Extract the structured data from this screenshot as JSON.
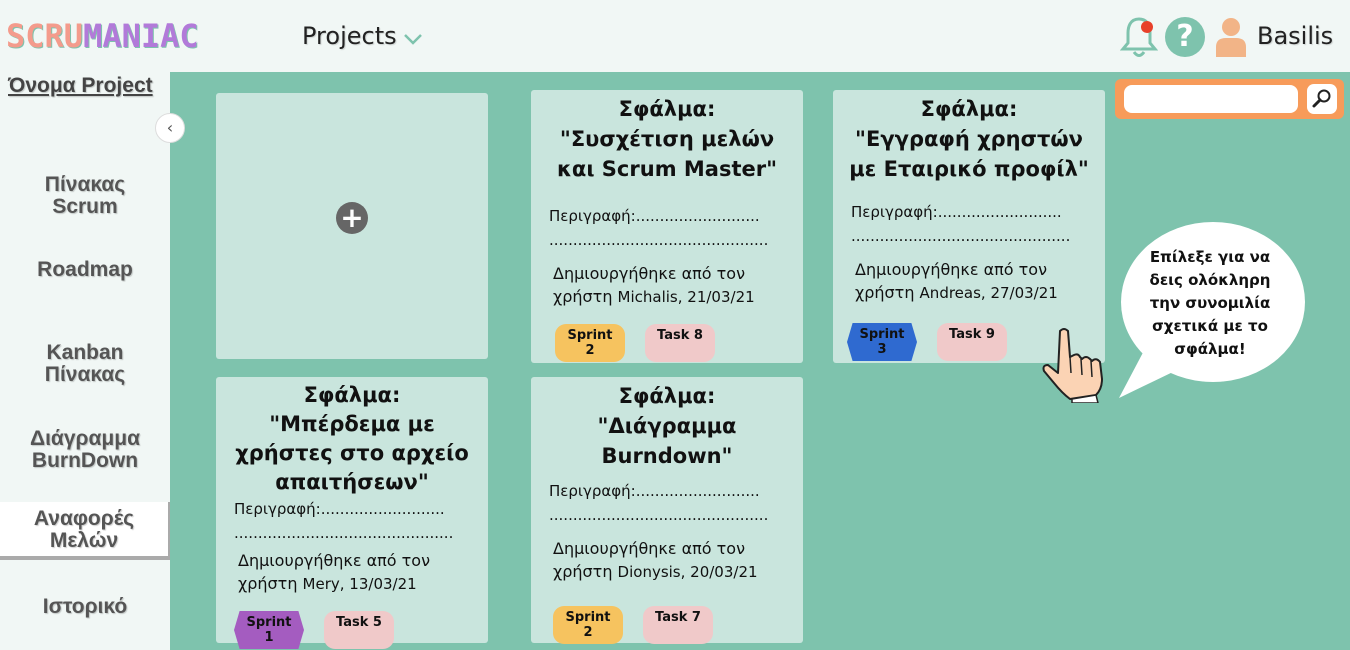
{
  "header": {
    "logo_part1": "SCRU",
    "logo_part2": "MANIAC",
    "projects_label": "Projects",
    "username": "Basilis",
    "help_symbol": "?",
    "icons": [
      "bell-icon",
      "help-icon",
      "user-icon",
      "chevron-down-icon"
    ],
    "notification_dot_color": "#e8402a"
  },
  "sidebar": {
    "project_name": "Όνομα Project",
    "collapse_symbol": "‹",
    "items": [
      {
        "label_line1": "Πίνακας",
        "label_line2": "Scrum"
      },
      {
        "label_line1": "Roadmap",
        "label_line2": ""
      },
      {
        "label_line1": "Kanban",
        "label_line2": "Πίνακας"
      },
      {
        "label_line1": "Διάγραμμα",
        "label_line2": "BurnDown"
      },
      {
        "label_line1": "Αναφορές",
        "label_line2": "Μελών",
        "active": true
      },
      {
        "label_line1": "Ιστορικό",
        "label_line2": ""
      }
    ]
  },
  "main": {
    "add_symbol": "+",
    "cards": [
      {
        "title_lines": [
          "Σφάλμα:",
          "\"Συσχέτιση μελών",
          "και Scrum Master\""
        ],
        "desc_line1": "Περιγραφή:..........................",
        "desc_line2": "..............................................",
        "created_line1": "Δημιουργήθηκε από τον",
        "created_prefix": "χρήστη",
        "created_who": "Michalis, 21/03/21",
        "sprint": "Sprint 2",
        "task": "Task 8"
      },
      {
        "title_lines": [
          "Σφάλμα:",
          "\"Εγγραφή χρηστών",
          "με Εταιρικό προφίλ\""
        ],
        "desc_line1": "Περιγραφή:..........................",
        "desc_line2": "..............................................",
        "created_line1": "Δημιουργήθηκε από τον",
        "created_prefix": "χρήστη",
        "created_who": "Andreas, 27/03/21",
        "sprint": "Sprint 3",
        "task": "Task 9"
      },
      {
        "title_lines": [
          "Σφάλμα:",
          "\"Μπέρδεμα με",
          "χρήστες στο αρχείο",
          "απαιτήσεων\""
        ],
        "desc_line1": "Περιγραφή:..........................",
        "desc_line2": "..............................................",
        "created_line1": "Δημιουργήθηκε από τον",
        "created_prefix": "χρήστη",
        "created_who": "Mery, 13/03/21",
        "sprint": "Sprint 1",
        "task": "Task 5"
      },
      {
        "title_lines": [
          "Σφάλμα:",
          "\"Διάγραμμα",
          "Burndown\""
        ],
        "desc_line1": "Περιγραφή:..........................",
        "desc_line2": "..............................................",
        "created_line1": "Δημιουργήθηκε από τον",
        "created_prefix": "χρήστη",
        "created_who": "Dionysis, 20/03/21",
        "sprint": "Sprint 2",
        "task": "Task 7"
      }
    ],
    "search": {
      "value": "",
      "icon": "search-icon"
    },
    "bubble_lines": [
      "Επίλεξε για να",
      "δεις ολόκληρη",
      "την συνομιλία",
      "σχετικά με το",
      "σφάλμα!"
    ]
  },
  "colors": {
    "background": "#f1f7f5",
    "main_bg": "#7ec3ad",
    "card_bg": "#c9e5dd",
    "search_frame": "#f79b5a",
    "sprint_yellow": "#f6c35f",
    "sprint_blue": "#2f6ad0",
    "sprint_purple": "#a45cc0",
    "task_pink": "#f0c9c9"
  }
}
